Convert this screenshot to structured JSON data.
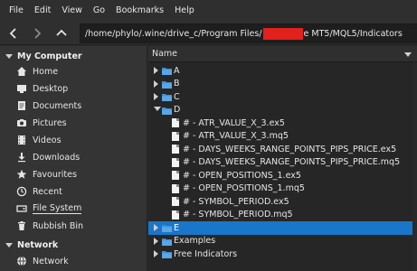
{
  "menubar": {
    "items": [
      "File",
      "Edit",
      "View",
      "Go",
      "Bookmarks",
      "Help"
    ]
  },
  "path": {
    "prefix": "/home/phylo/.wine/drive_c/Program Files/",
    "suffix": "e MT5/MQL5/Indicators"
  },
  "sidebar": {
    "my_computer": "My Computer",
    "items": [
      "Home",
      "Desktop",
      "Documents",
      "Pictures",
      "Videos",
      "Downloads",
      "Favourites",
      "Recent",
      "File System",
      "Rubbish Bin"
    ],
    "network_header": "Network",
    "network_items": [
      "Network"
    ]
  },
  "filelist": {
    "column_name": "Name",
    "rows": [
      "A",
      "B",
      "C",
      "D",
      "# - ATR_VALUE_X_3.ex5",
      "# - ATR_VALUE_X_3.mq5",
      "# - DAYS_WEEKS_RANGE_POINTS_PIPS_PRICE.ex5",
      "# - DAYS_WEEKS_RANGE_POINTS_PIPS_PRICE.mq5",
      "# - OPEN_POSITIONS_1.ex5",
      "# - OPEN_POSITIONS_1.mq5",
      "# - SYMBOL_PERIOD.ex5",
      "# - SYMBOL_PERIOD.mq5",
      "E",
      "Examples",
      "Free Indicators"
    ],
    "selected_row": "E"
  },
  "colors": {
    "selection": "#1976c8",
    "folder": "#3f8fd2",
    "redaction": "#e2201c"
  }
}
